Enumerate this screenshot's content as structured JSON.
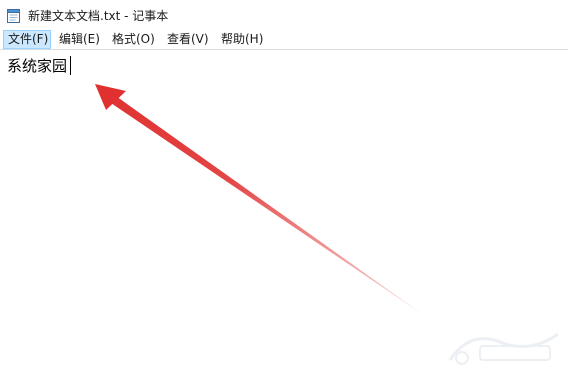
{
  "window": {
    "title": "新建文本文档.txt - 记事本"
  },
  "menubar": {
    "items": [
      {
        "label": "文件(F)",
        "active": true
      },
      {
        "label": "编辑(E)",
        "active": false
      },
      {
        "label": "格式(O)",
        "active": false
      },
      {
        "label": "查看(V)",
        "active": false
      },
      {
        "label": "帮助(H)",
        "active": false
      }
    ]
  },
  "editor": {
    "content": "系统家园"
  },
  "annotation": {
    "arrow_color": "#e03030"
  },
  "colors": {
    "menu_highlight": "#cce8ff",
    "menu_highlight_border": "#99d1ff"
  }
}
